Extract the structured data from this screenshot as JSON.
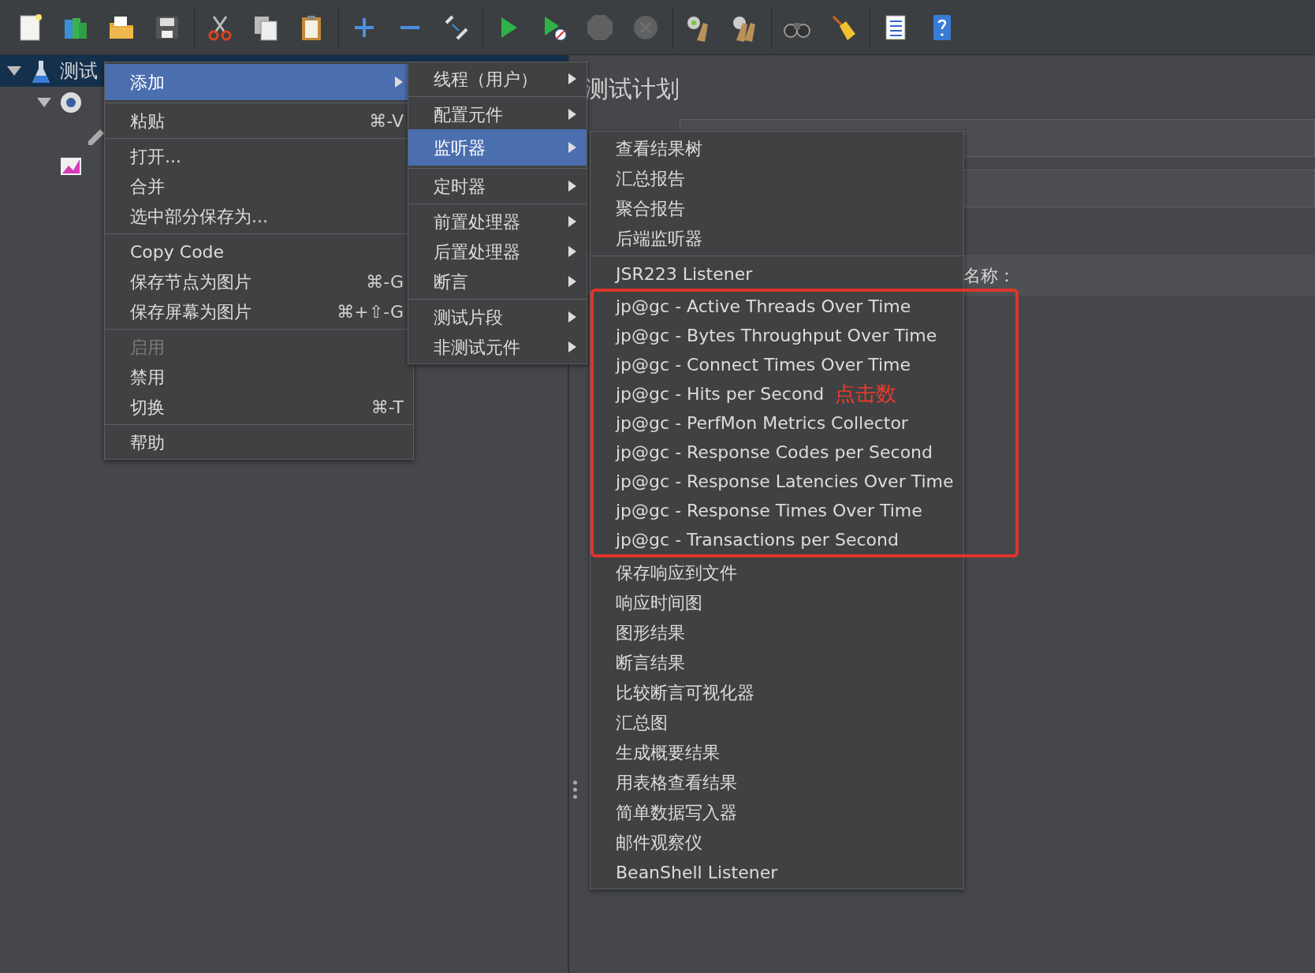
{
  "toolbar": [
    [
      {
        "disabled": false
      },
      {
        "disabled": false
      },
      {
        "disabled": false
      },
      {
        "disabled": false
      }
    ],
    [
      {
        "disabled": false
      },
      {
        "disabled": false
      },
      {
        "disabled": false
      }
    ],
    [
      {
        "disabled": false
      },
      {
        "disabled": false
      },
      {
        "disabled": false
      }
    ],
    [
      {
        "disabled": false
      },
      {
        "disabled": false
      },
      {
        "disabled": true
      },
      {
        "disabled": true
      }
    ],
    [
      {
        "disabled": false
      },
      {
        "disabled": false
      }
    ],
    [
      {
        "disabled": false
      },
      {
        "disabled": false
      }
    ],
    [
      {
        "disabled": false
      },
      {
        "disabled": false
      }
    ]
  ],
  "tree": [
    {
      "kind": "plan",
      "label": "测试",
      "expanded": true,
      "selected": true,
      "children": [
        {
          "kind": "thread-group",
          "expanded": true,
          "children": [
            {
              "kind": "sampler"
            }
          ]
        },
        {
          "kind": "listener"
        }
      ]
    }
  ],
  "panel": {
    "title": "测试计划",
    "label": "名称："
  },
  "menus": [
    {
      "sections": [
        [
          {
            "kind": "item",
            "label": "添加",
            "submenu": true,
            "selected": true
          }
        ],
        [
          {
            "kind": "item",
            "label": "粘贴",
            "shortcut": "⌘-V"
          }
        ],
        [
          {
            "kind": "item",
            "label": "打开..."
          },
          {
            "kind": "item",
            "label": "合并"
          },
          {
            "kind": "item",
            "label": "选中部分保存为..."
          }
        ],
        [
          {
            "kind": "item",
            "label": "Copy Code"
          },
          {
            "kind": "item",
            "label": "保存节点为图片",
            "shortcut": "⌘-G"
          },
          {
            "kind": "item",
            "label": "保存屏幕为图片",
            "shortcut": "⌘+⇧-G"
          }
        ],
        [
          {
            "kind": "item",
            "label": "启用",
            "disabled": true
          },
          {
            "kind": "item",
            "label": "禁用"
          },
          {
            "kind": "item",
            "label": "切换",
            "shortcut": "⌘-T"
          }
        ],
        [
          {
            "kind": "item",
            "label": "帮助"
          }
        ]
      ]
    },
    {
      "sections": [
        [
          {
            "kind": "item",
            "label": "线程（用户）",
            "submenu": true
          }
        ],
        [
          {
            "kind": "item",
            "label": "配置元件",
            "submenu": true
          },
          {
            "kind": "item",
            "label": "监听器",
            "submenu": true,
            "selected": true
          }
        ],
        [
          {
            "kind": "item",
            "label": "定时器",
            "submenu": true
          }
        ],
        [
          {
            "kind": "item",
            "label": "前置处理器",
            "submenu": true
          },
          {
            "kind": "item",
            "label": "后置处理器",
            "submenu": true
          },
          {
            "kind": "item",
            "label": "断言",
            "submenu": true
          }
        ],
        [
          {
            "kind": "item",
            "label": "测试片段",
            "submenu": true
          },
          {
            "kind": "item",
            "label": "非测试元件",
            "submenu": true
          }
        ]
      ]
    },
    {
      "sections": [
        [
          {
            "kind": "item",
            "label": "查看结果树"
          },
          {
            "kind": "item",
            "label": "汇总报告"
          },
          {
            "kind": "item",
            "label": "聚合报告"
          },
          {
            "kind": "item",
            "label": "后端监听器"
          }
        ],
        [
          {
            "kind": "item",
            "label": "JSR223 Listener"
          },
          {
            "kind": "callout",
            "items": [
              {
                "kind": "item",
                "label": "jp@gc - Active Threads Over Time"
              },
              {
                "kind": "item",
                "label": "jp@gc - Bytes Throughput Over Time"
              },
              {
                "kind": "item",
                "label": "jp@gc - Connect Times Over Time"
              },
              {
                "kind": "item",
                "label": "jp@gc - Hits per Second",
                "note": "点击数"
              },
              {
                "kind": "item",
                "label": "jp@gc - PerfMon Metrics Collector"
              },
              {
                "kind": "item",
                "label": "jp@gc - Response Codes per Second"
              },
              {
                "kind": "item",
                "label": "jp@gc - Response Latencies Over Time"
              },
              {
                "kind": "item",
                "label": "jp@gc - Response Times Over Time"
              },
              {
                "kind": "item",
                "label": "jp@gc - Transactions per Second"
              }
            ]
          },
          {
            "kind": "item",
            "label": "保存响应到文件"
          },
          {
            "kind": "item",
            "label": "响应时间图"
          },
          {
            "kind": "item",
            "label": "图形结果"
          },
          {
            "kind": "item",
            "label": "断言结果"
          },
          {
            "kind": "item",
            "label": "比较断言可视化器"
          },
          {
            "kind": "item",
            "label": "汇总图"
          },
          {
            "kind": "item",
            "label": "生成概要结果"
          },
          {
            "kind": "item",
            "label": "用表格查看结果"
          },
          {
            "kind": "item",
            "label": "简单数据写入器"
          },
          {
            "kind": "item",
            "label": "邮件观察仪"
          },
          {
            "kind": "item",
            "label": "BeanShell Listener"
          }
        ]
      ]
    }
  ]
}
